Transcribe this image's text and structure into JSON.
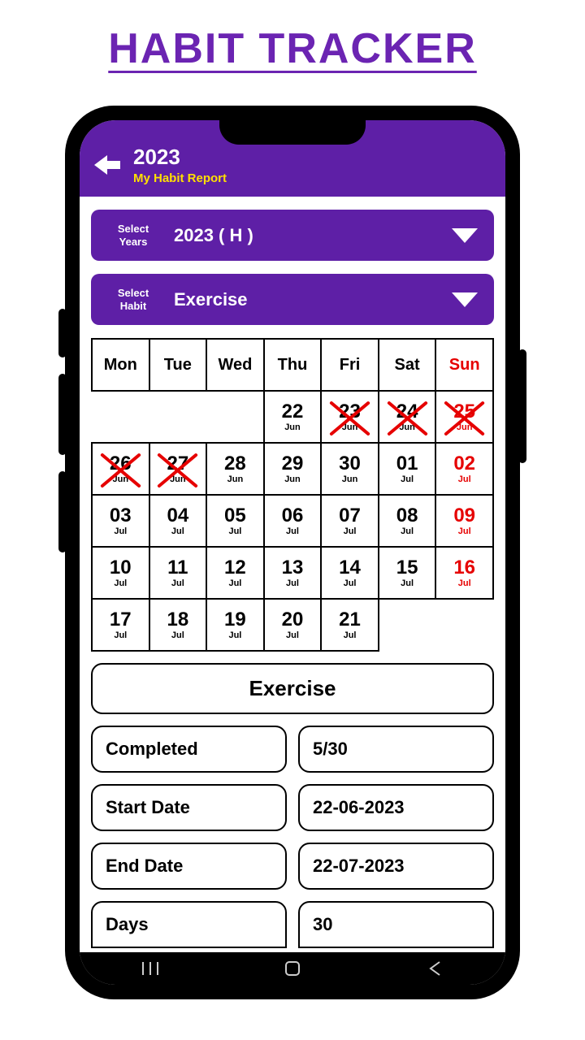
{
  "page": {
    "title": "HABIT TRACKER"
  },
  "header": {
    "year": "2023",
    "subtitle": "My Habit Report"
  },
  "selectors": {
    "years": {
      "label": "Select\nYears",
      "value": "2023 ( H )"
    },
    "habit": {
      "label": "Select\nHabit",
      "value": "Exercise"
    }
  },
  "calendar": {
    "weekdays": [
      "Mon",
      "Tue",
      "Wed",
      "Thu",
      "Fri",
      "Sat",
      "Sun"
    ],
    "rows": [
      [
        null,
        null,
        null,
        {
          "d": "22",
          "m": "Jun"
        },
        {
          "d": "23",
          "m": "Jun",
          "x": true
        },
        {
          "d": "24",
          "m": "Jun",
          "x": true
        },
        {
          "d": "25",
          "m": "Jun",
          "x": true,
          "sun": true
        }
      ],
      [
        {
          "d": "26",
          "m": "Jun",
          "x": true
        },
        {
          "d": "27",
          "m": "Jun",
          "x": true
        },
        {
          "d": "28",
          "m": "Jun"
        },
        {
          "d": "29",
          "m": "Jun"
        },
        {
          "d": "30",
          "m": "Jun"
        },
        {
          "d": "01",
          "m": "Jul"
        },
        {
          "d": "02",
          "m": "Jul",
          "sun": true
        }
      ],
      [
        {
          "d": "03",
          "m": "Jul"
        },
        {
          "d": "04",
          "m": "Jul"
        },
        {
          "d": "05",
          "m": "Jul"
        },
        {
          "d": "06",
          "m": "Jul"
        },
        {
          "d": "07",
          "m": "Jul"
        },
        {
          "d": "08",
          "m": "Jul"
        },
        {
          "d": "09",
          "m": "Jul",
          "sun": true
        }
      ],
      [
        {
          "d": "10",
          "m": "Jul"
        },
        {
          "d": "11",
          "m": "Jul"
        },
        {
          "d": "12",
          "m": "Jul"
        },
        {
          "d": "13",
          "m": "Jul"
        },
        {
          "d": "14",
          "m": "Jul"
        },
        {
          "d": "15",
          "m": "Jul"
        },
        {
          "d": "16",
          "m": "Jul",
          "sun": true
        }
      ],
      [
        {
          "d": "17",
          "m": "Jul"
        },
        {
          "d": "18",
          "m": "Jul"
        },
        {
          "d": "19",
          "m": "Jul"
        },
        {
          "d": "20",
          "m": "Jul"
        },
        {
          "d": "21",
          "m": "Jul"
        },
        null,
        null
      ]
    ]
  },
  "summary": {
    "habit_name": "Exercise",
    "stats": [
      {
        "label": "Completed",
        "value": "5/30"
      },
      {
        "label": "Start Date",
        "value": "22-06-2023"
      },
      {
        "label": "End Date",
        "value": "22-07-2023"
      },
      {
        "label": "Days",
        "value": "30"
      }
    ]
  }
}
